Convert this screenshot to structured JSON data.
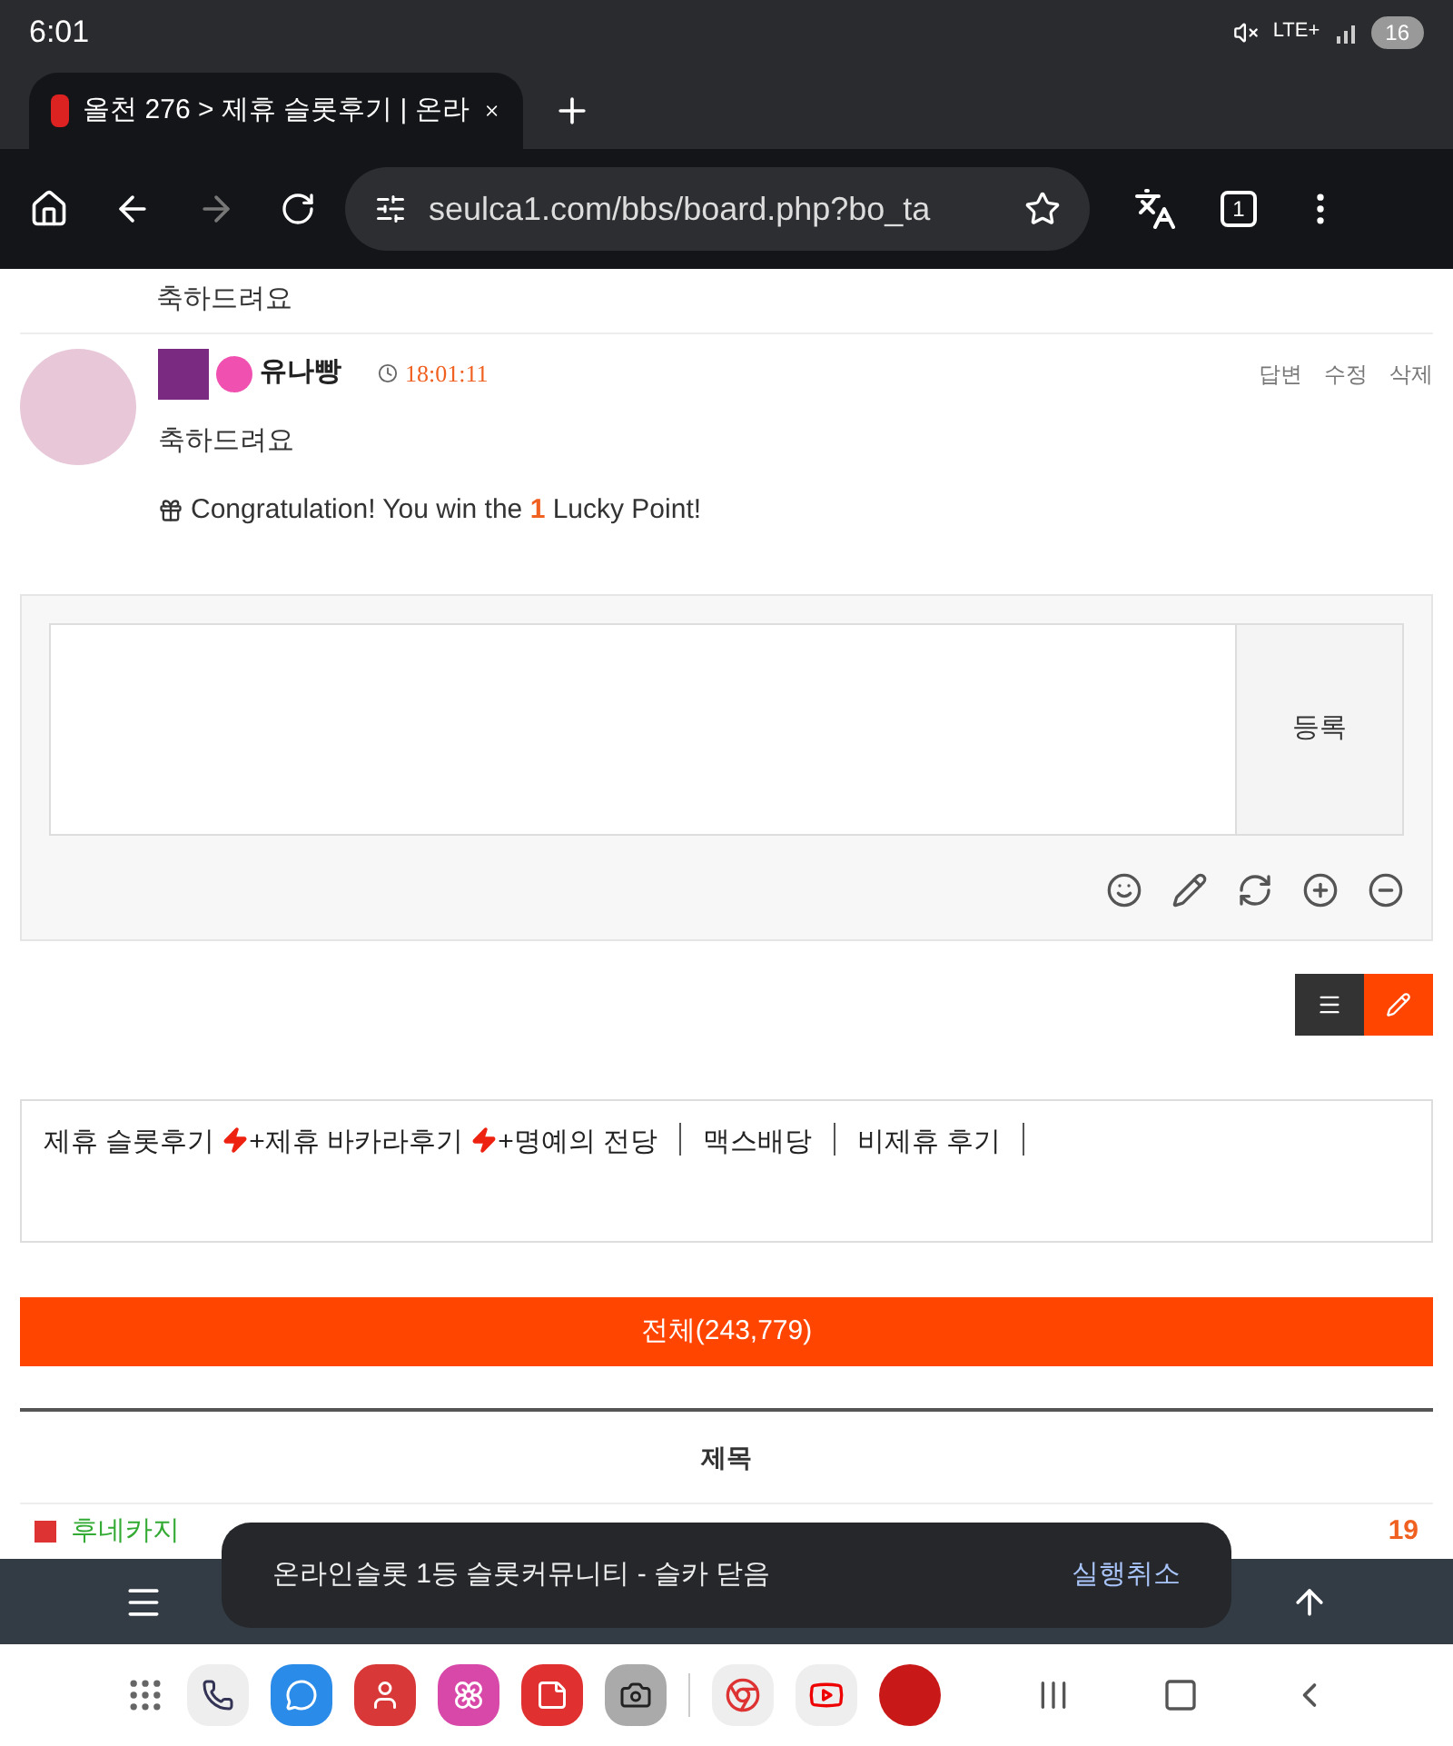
{
  "status_bar": {
    "time": "6:01",
    "network": "LTE+",
    "battery": "16"
  },
  "browser": {
    "tab": {
      "title": "올천 276 > 제휴 슬롯후기 | 온라",
      "selected": true
    },
    "url": "seulca1.com/bbs/board.php?bo_ta",
    "tab_count": "1"
  },
  "comments": [
    {
      "text": "축하드려요"
    },
    {
      "author": "유나빵",
      "time": "18:01:11",
      "text": "축하드려요",
      "actions": [
        "답변",
        "수정",
        "삭제"
      ],
      "lucky": {
        "before": "Congratulation! You win the",
        "points": "1",
        "after": "Lucky Point!"
      }
    }
  ],
  "comment_form": {
    "submit": "등록"
  },
  "categories": [
    {
      "label": "제휴 슬롯후기",
      "kind": "bolt"
    },
    {
      "label": "+제휴 바카라후기",
      "kind": "bolt"
    },
    {
      "label": "+명예의 전당",
      "kind": "bar"
    },
    {
      "label": "맥스배당",
      "kind": "bar"
    },
    {
      "label": "비제휴 후기",
      "kind": "bar"
    }
  ],
  "total_button": "전체(243,779)",
  "table": {
    "columns": [
      "제목"
    ],
    "rows": [
      {
        "title": "후네카지",
        "count": "19"
      }
    ]
  },
  "toast": {
    "message": "온라인슬롯 1등 슬롯커뮤니티 - 슬카 닫음",
    "action": "실행취소"
  }
}
